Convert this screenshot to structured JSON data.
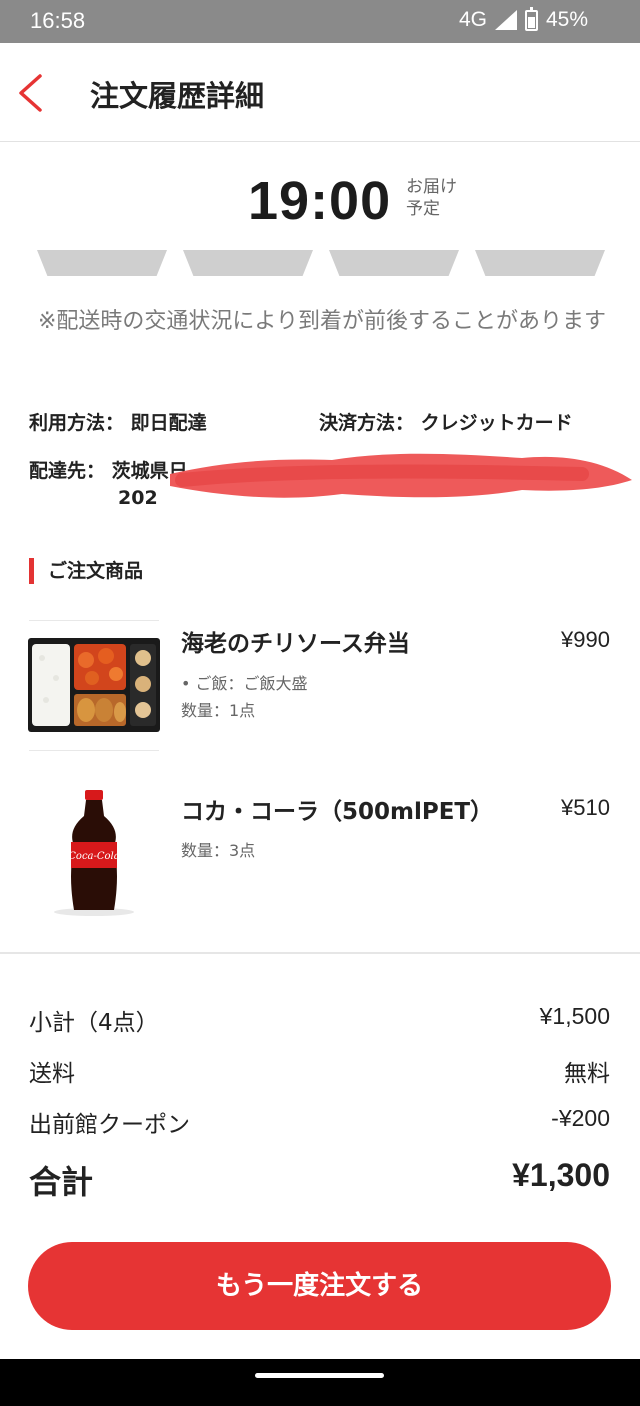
{
  "status_bar": {
    "time": "16:58",
    "network": "4G",
    "battery": "45%"
  },
  "header": {
    "back_icon": "chevron-left-icon",
    "title": "注文履歴詳細"
  },
  "delivery": {
    "eta_time": "19:00",
    "eta_label_line1": "お届け",
    "eta_label_line2": "予定",
    "progress_steps_total": 4,
    "notice": "※配送時の交通状況により到着が前後することがあります"
  },
  "order_info": {
    "usage_label": "利用方法：",
    "usage_value": "即日配達",
    "payment_label": "決済方法：",
    "payment_value": "クレジットカード",
    "address_label": "配達先：",
    "address_line1_visible": "茨城県日",
    "address_line2_visible": "202"
  },
  "items_section": {
    "title": "ご注文商品",
    "items": [
      {
        "name": "海老のチリソース弁当",
        "price": "¥990",
        "option": "• ご飯：ご飯大盛",
        "quantity": "数量：1点"
      },
      {
        "name": "コカ・コーラ（500mlPET）",
        "price": "¥510",
        "quantity": "数量：3点"
      }
    ]
  },
  "summary": {
    "subtotal_label": "小計（4点）",
    "subtotal_value": "¥1,500",
    "shipping_label": "送料",
    "shipping_value": "無料",
    "coupon_label": "出前館クーポン",
    "coupon_value": "-¥200",
    "total_label": "合計",
    "total_value": "¥1,300"
  },
  "actions": {
    "reorder_label": "もう一度注文する"
  },
  "colors": {
    "accent": "#e63434",
    "status_bar": "#8a8a8a",
    "progress_inactive": "#cfcfcf"
  }
}
